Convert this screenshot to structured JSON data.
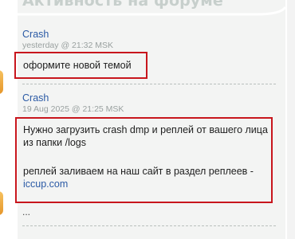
{
  "forum_panel": {
    "title": "Активность на форуме"
  },
  "posts": [
    {
      "author": "Crash",
      "date": "yesterday @ 21:32 MSK",
      "text": "оформите новой темой"
    },
    {
      "author": "Crash",
      "date": "19 Aug 2025 @ 21:25 MSK",
      "text_line1": "Нужно загрузить crash dmp и реплей от вашего лица",
      "text_line2": "из папки /logs",
      "text_line3": "реплей заливаем на наш сайт в раздел реплеев -",
      "link": "iccup.com"
    }
  ],
  "more": "...",
  "colors": {
    "highlight": "#c8161d",
    "link": "#2b5aa5",
    "panel_bg": "#f3f4f3",
    "accent_tab": "#e6962a"
  }
}
